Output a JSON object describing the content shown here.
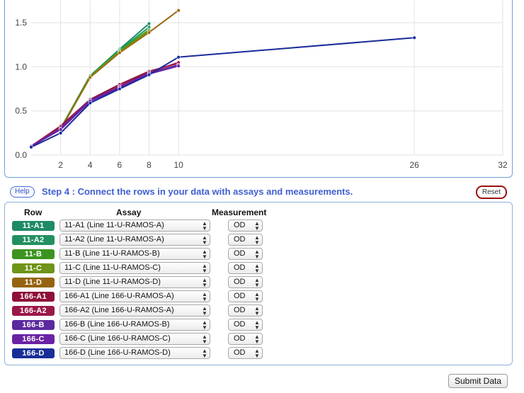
{
  "chart_data": {
    "type": "line",
    "x_ticks": [
      2,
      4,
      6,
      8,
      10,
      26,
      32
    ],
    "y_ticks": [
      0.0,
      0.5,
      1.0,
      1.5
    ],
    "y_tick_labels": [
      "0.0",
      "0.5",
      "1.0",
      "1.5"
    ],
    "xlim": [
      0,
      32
    ],
    "ylim": [
      0,
      1.75
    ],
    "grid": true,
    "series": [
      {
        "color": "#1a8a6e",
        "x": [
          0,
          2,
          4,
          6,
          8
        ],
        "y": [
          0.1,
          0.3,
          0.9,
          1.2,
          1.49
        ]
      },
      {
        "color": "#229a5a",
        "x": [
          0,
          2,
          4,
          6,
          8
        ],
        "y": [
          0.1,
          0.3,
          0.9,
          1.19,
          1.45
        ]
      },
      {
        "color": "#3f9a1a",
        "x": [
          0,
          2,
          4,
          6,
          8
        ],
        "y": [
          0.1,
          0.3,
          0.89,
          1.18,
          1.42
        ]
      },
      {
        "color": "#6f9a10",
        "x": [
          0,
          2,
          4,
          6,
          8
        ],
        "y": [
          0.1,
          0.29,
          0.89,
          1.17,
          1.41
        ]
      },
      {
        "color": "#9a6a10",
        "x": [
          0,
          2,
          4,
          6,
          8,
          10
        ],
        "y": [
          0.1,
          0.29,
          0.88,
          1.16,
          1.39,
          1.64
        ]
      },
      {
        "color": "#8a1040",
        "x": [
          0,
          2,
          4,
          6,
          8,
          10
        ],
        "y": [
          0.1,
          0.33,
          0.63,
          0.8,
          0.95,
          1.04
        ]
      },
      {
        "color": "#a01850",
        "x": [
          0,
          2,
          4,
          6,
          8,
          10
        ],
        "y": [
          0.1,
          0.32,
          0.62,
          0.78,
          0.94,
          1.05
        ]
      },
      {
        "color": "#5a2aa0",
        "x": [
          0,
          2,
          4,
          6,
          8,
          10
        ],
        "y": [
          0.1,
          0.3,
          0.62,
          0.77,
          0.93,
          1.02
        ]
      },
      {
        "color": "#6a20a8",
        "x": [
          0,
          2,
          4,
          6,
          8,
          10
        ],
        "y": [
          0.1,
          0.29,
          0.61,
          0.76,
          0.92,
          1.01
        ]
      },
      {
        "color": "#1a2a9a",
        "x": [
          0,
          2,
          4,
          6,
          8,
          10,
          26
        ],
        "y": [
          0.09,
          0.25,
          0.59,
          0.75,
          0.91,
          1.11,
          1.33
        ]
      }
    ]
  },
  "step": {
    "help_label": "Help",
    "title": "Step 4 : Connect the rows in your data with assays and measurements.",
    "reset_label": "Reset"
  },
  "table": {
    "headers": {
      "row": "Row",
      "assay": "Assay",
      "measurement": "Measurement"
    },
    "rows": [
      {
        "id": "11-A1",
        "color": "#1e8a66",
        "assay": "11-A1 (Line 11-U-RAMOS-A)",
        "measurement": "OD"
      },
      {
        "id": "11-A2",
        "color": "#229060",
        "assay": "11-A2 (Line 11-U-RAMOS-A)",
        "measurement": "OD"
      },
      {
        "id": "11-B",
        "color": "#3c9420",
        "assay": "11-B (Line 11-U-RAMOS-B)",
        "measurement": "OD"
      },
      {
        "id": "11-C",
        "color": "#6e9418",
        "assay": "11-C (Line 11-U-RAMOS-C)",
        "measurement": "OD"
      },
      {
        "id": "11-D",
        "color": "#966410",
        "assay": "11-D (Line 11-U-RAMOS-D)",
        "measurement": "OD"
      },
      {
        "id": "166-A1",
        "color": "#8e1038",
        "assay": "166-A1 (Line 166-U-RAMOS-A)",
        "measurement": "OD"
      },
      {
        "id": "166-A2",
        "color": "#9a1848",
        "assay": "166-A2 (Line 166-U-RAMOS-A)",
        "measurement": "OD"
      },
      {
        "id": "166-B",
        "color": "#5a2a9e",
        "assay": "166-B (Line 166-U-RAMOS-B)",
        "measurement": "OD"
      },
      {
        "id": "166-C",
        "color": "#6a22a4",
        "assay": "166-C (Line 166-U-RAMOS-C)",
        "measurement": "OD"
      },
      {
        "id": "166-D",
        "color": "#1a2e98",
        "assay": "166-D (Line 166-U-RAMOS-D)",
        "measurement": "OD"
      }
    ]
  },
  "submit_label": "Submit Data"
}
